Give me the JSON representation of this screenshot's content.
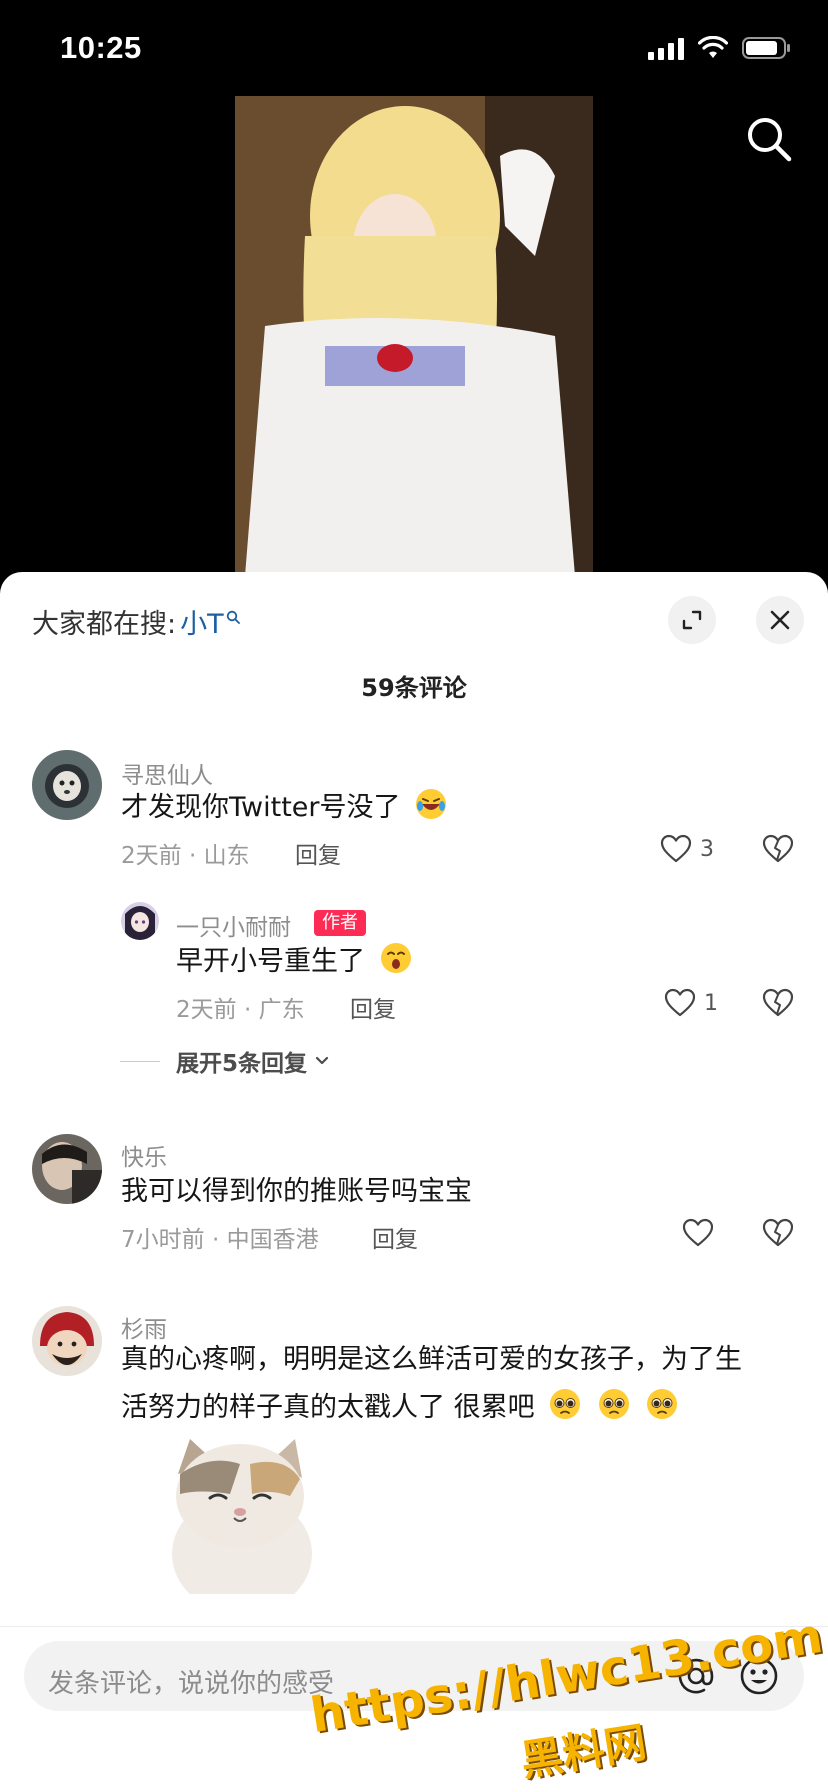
{
  "status": {
    "time": "10:25"
  },
  "sheet": {
    "hot_search_label": "大家都在搜:",
    "hot_search_term": "小T",
    "comment_count": "59条评论"
  },
  "comments": [
    {
      "user": "寻思仙人",
      "text": "才发现你Twitter号没了",
      "meta": "2天前 · 山东",
      "reply": "回复",
      "likes": "3"
    },
    {
      "user": "一只小耐耐",
      "badge": "作者",
      "text": "早开小号重生了",
      "meta": "2天前 · 广东",
      "reply": "回复",
      "likes": "1",
      "expand": "展开5条回复"
    },
    {
      "user": "快乐",
      "text": "我可以得到你的推账号吗宝宝",
      "meta": "7小时前 · 中国香港",
      "reply": "回复"
    },
    {
      "user": "杉雨",
      "text_line1": "真的心疼啊，明明是这么鲜活可爱的女孩子，为了生",
      "text_line2": "活努力的样子真的太戳人了 很累吧"
    }
  ],
  "input": {
    "placeholder": "发条评论，说说你的感受"
  },
  "watermark": {
    "line1": "https://hlwc13.com",
    "line2": "黑料网"
  },
  "icons": {
    "search": "search-icon",
    "expand": "expand-icon",
    "close": "close-icon",
    "like": "heart-icon",
    "dislike": "broken-heart-icon",
    "at": "at-icon",
    "emoji": "emoji-icon"
  }
}
